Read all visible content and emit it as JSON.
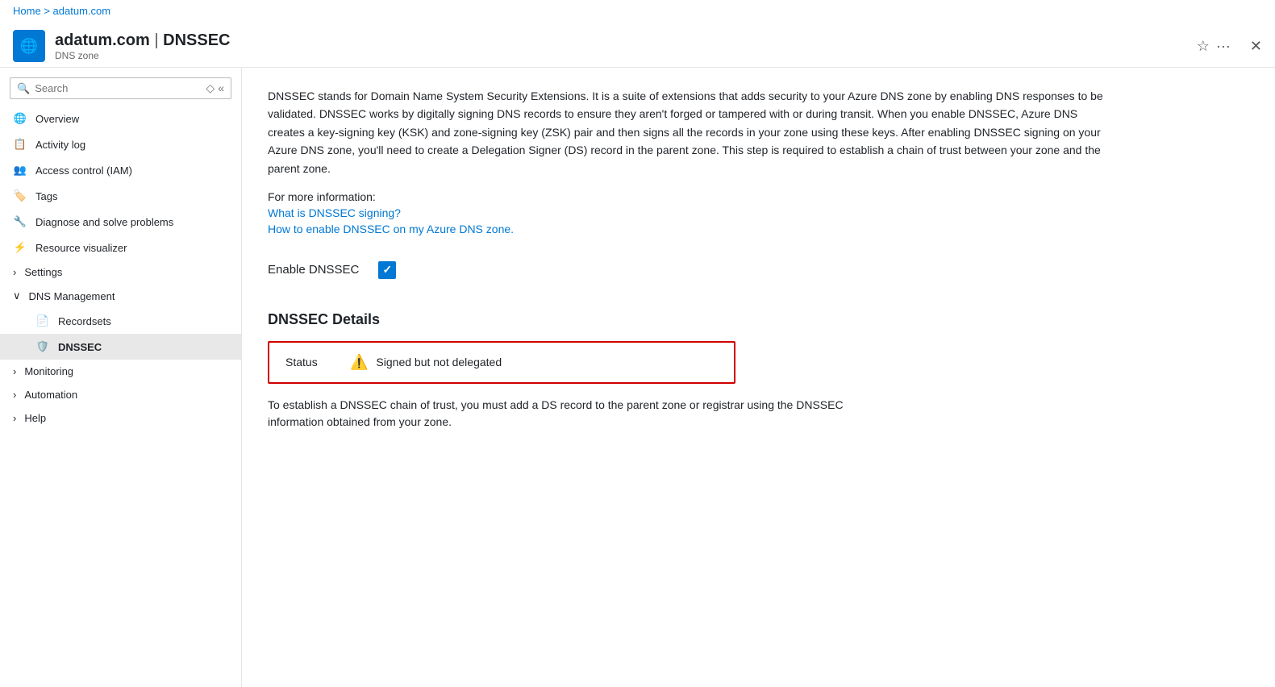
{
  "breadcrumb": {
    "home": "Home",
    "separator": ">",
    "current": "adatum.com"
  },
  "header": {
    "title_main": "adatum.com",
    "title_pipe": "|",
    "title_section": "DNSSEC",
    "subtitle": "DNS zone",
    "star_icon": "☆",
    "dots_icon": "···",
    "close_icon": "✕"
  },
  "sidebar": {
    "search_placeholder": "Search",
    "items": [
      {
        "id": "overview",
        "label": "Overview",
        "icon": "globe"
      },
      {
        "id": "activity-log",
        "label": "Activity log",
        "icon": "doc"
      },
      {
        "id": "iam",
        "label": "Access control (IAM)",
        "icon": "people"
      },
      {
        "id": "tags",
        "label": "Tags",
        "icon": "tag"
      },
      {
        "id": "diagnose",
        "label": "Diagnose and solve problems",
        "icon": "wrench"
      },
      {
        "id": "visualizer",
        "label": "Resource visualizer",
        "icon": "network"
      }
    ],
    "sections": [
      {
        "id": "settings",
        "label": "Settings",
        "expanded": false
      },
      {
        "id": "dns-management",
        "label": "DNS Management",
        "expanded": true,
        "children": [
          {
            "id": "recordsets",
            "label": "Recordsets"
          },
          {
            "id": "dnssec",
            "label": "DNSSEC",
            "active": true
          }
        ]
      },
      {
        "id": "monitoring",
        "label": "Monitoring",
        "expanded": false
      },
      {
        "id": "automation",
        "label": "Automation",
        "expanded": false
      },
      {
        "id": "help",
        "label": "Help",
        "expanded": false
      }
    ]
  },
  "content": {
    "description": "DNSSEC stands for Domain Name System Security Extensions. It is a suite of extensions that adds security to your Azure DNS zone by enabling DNS responses to be validated. DNSSEC works by digitally signing DNS records to ensure they aren't forged or tampered with or during transit. When you enable DNSSEC, Azure DNS creates a key-signing key (KSK) and zone-signing key (ZSK) pair and then signs all the records in your zone using these keys. After enabling DNSSEC signing on your Azure DNS zone, you'll need to create a Delegation Signer (DS) record in the parent zone. This step is required to establish a chain of trust between your zone and the parent zone.",
    "more_info_label": "For more information:",
    "link1": "What is DNSSEC signing?",
    "link2": "How to enable DNSSEC on my Azure DNS zone.",
    "enable_label": "Enable DNSSEC",
    "details_title": "DNSSEC Details",
    "status_label": "Status",
    "status_value": "Signed but not delegated",
    "chain_text": "To establish a DNSSEC chain of trust, you must add a DS record to the parent zone or registrar using the DNSSEC information obtained from your zone."
  }
}
